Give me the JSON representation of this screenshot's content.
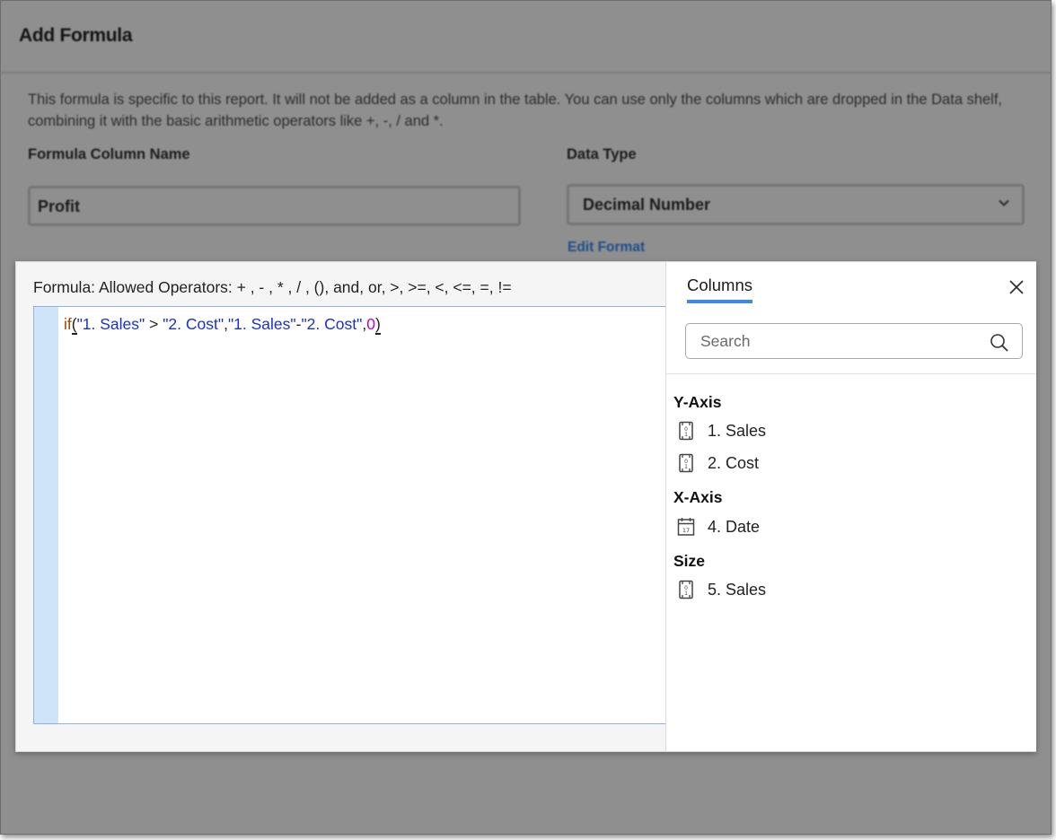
{
  "background_dialog": {
    "title": "Add Formula",
    "description": "This formula is specific to this report. It will not be added as a column in the table. You can use only the columns which are dropped in the Data shelf, combining it with the basic arithmetic operators like +, -, / and *.",
    "formula_column_name_label": "Formula Column Name",
    "formula_column_name_value": "Profit",
    "data_type_label": "Data Type",
    "data_type_value": "Decimal Number",
    "edit_format_label": "Edit Format"
  },
  "formula_panel": {
    "hint": "Formula: Allowed Operators: + , - , * , / , (), and, or, >, >=, <, <=, =, !=",
    "code": {
      "fn": "if",
      "open_paren": "(",
      "arg1_left": "\"1. Sales\"",
      "cmp": " > ",
      "arg1_right": "\"2. Cost\"",
      "sep1": ",",
      "arg2_left": "\"1. Sales\"",
      "minus": "-",
      "arg2_right": "\"2. Cost\"",
      "sep2": ",",
      "arg3": "0",
      "close_paren": ")"
    }
  },
  "columns_pane": {
    "tab_label": "Columns",
    "search_placeholder": "Search",
    "groups": [
      {
        "title": "Y-Axis",
        "items": [
          {
            "label": "1. Sales",
            "icon": "numeric-column-icon"
          },
          {
            "label": "2. Cost",
            "icon": "numeric-column-icon"
          }
        ]
      },
      {
        "title": "X-Axis",
        "items": [
          {
            "label": "4. Date",
            "icon": "calendar-icon"
          }
        ]
      },
      {
        "title": "Size",
        "items": [
          {
            "label": "5. Sales",
            "icon": "numeric-column-icon"
          }
        ]
      }
    ]
  },
  "colors": {
    "accent": "#3c8ae6",
    "gutter": "#cfe4f9",
    "keyword": "#a04400",
    "string": "#1b2fd0",
    "number": "#c400c4"
  }
}
